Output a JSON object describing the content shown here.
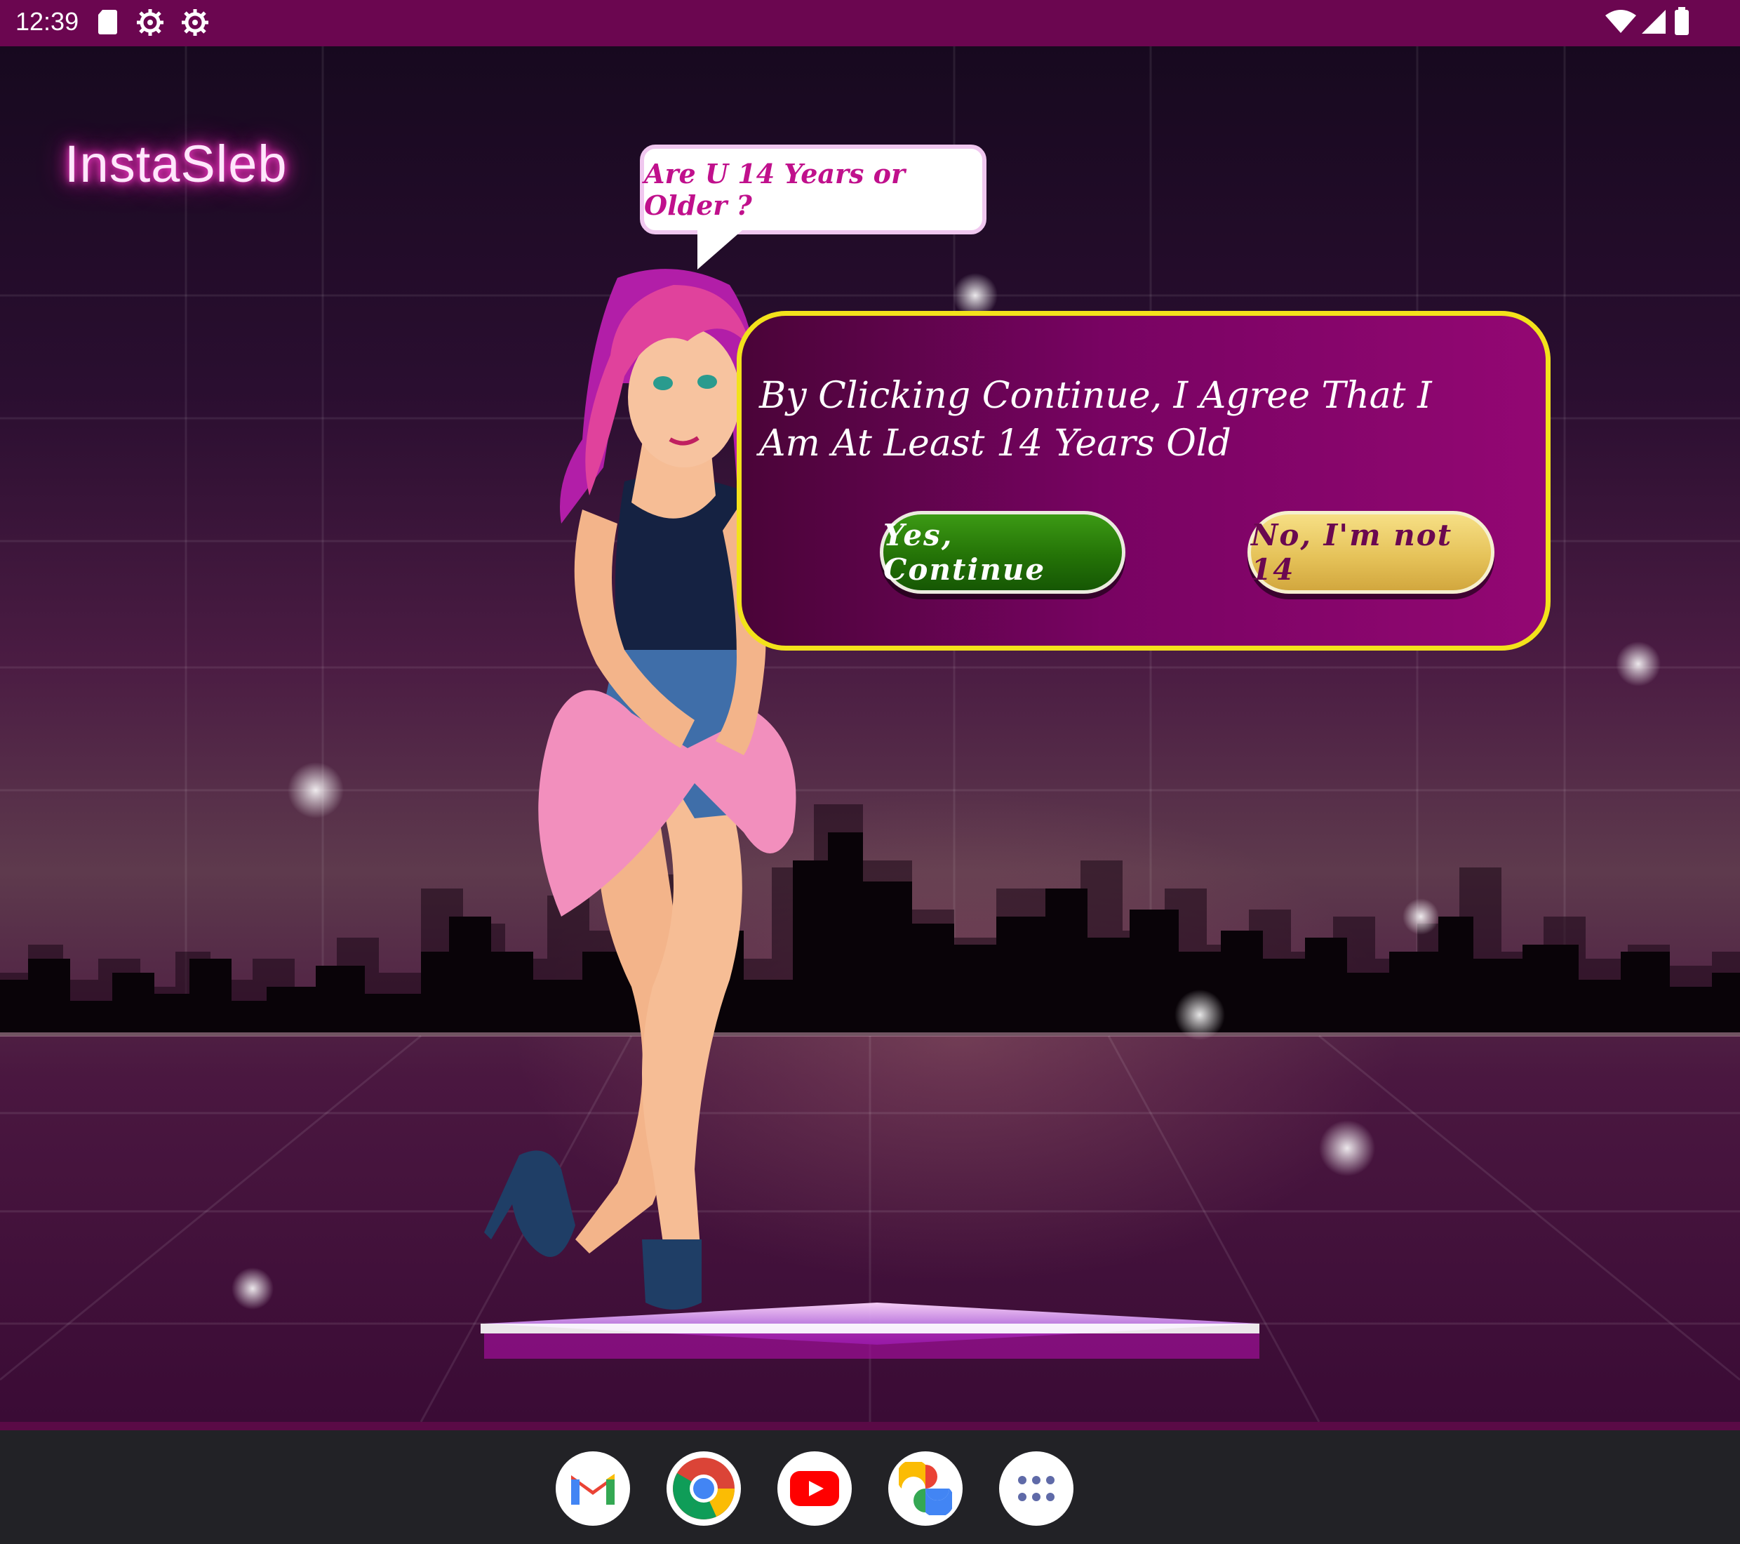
{
  "status_bar": {
    "time": "12:39",
    "left_icons": [
      "sd-card-icon",
      "settings-gear-icon",
      "settings-gear-icon"
    ],
    "right_icons": [
      "wifi-icon",
      "cell-signal-icon",
      "battery-icon"
    ]
  },
  "app": {
    "logo_text": "InstaSleb",
    "speech_bubble": "Are U 14 Years or Older ?",
    "dialog": {
      "message": "By Clicking Continue, I Agree That I Am At Least 14 Years Old",
      "yes_button": "Yes, Continue",
      "no_button": "No, I'm not 14"
    }
  },
  "dock": {
    "apps": [
      "gmail-icon",
      "chrome-icon",
      "youtube-icon",
      "photos-icon",
      "app-drawer-icon"
    ]
  },
  "colors": {
    "status_bar": "#6b0650",
    "dialog_border": "#f3e21b",
    "yes_button": "#247307",
    "no_button": "#e6c35a",
    "speech_text": "#c0108c"
  }
}
